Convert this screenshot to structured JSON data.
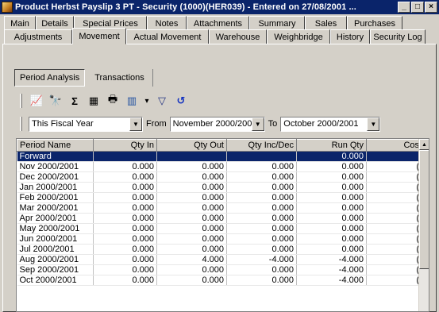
{
  "window": {
    "title": "Product Herbst  Payslip 3 PT - Security (1000)(HER039) - Entered on 27/08/2001 ...",
    "controls": [
      "_",
      "□",
      "×"
    ]
  },
  "tabs_row1": [
    "Main",
    "Details",
    "Special Prices",
    "Notes",
    "Attachments",
    "Summary",
    "Sales",
    "Purchases"
  ],
  "tabs_row2": [
    "Adjustments",
    "Movement",
    "Actual Movement",
    "Warehouse",
    "Weighbridge",
    "History",
    "Security Log"
  ],
  "active_tab": "Movement",
  "subtabs": {
    "period": "Period Analysis",
    "transactions": "Transactions"
  },
  "toolbar": {
    "icons": [
      "chart-icon",
      "binoculars-icon",
      "sum-icon",
      "export-icon",
      "print-icon",
      "columns-icon",
      "dropdown-arrow-icon",
      "filter-icon",
      "refresh-icon"
    ],
    "glyphs": [
      "📈",
      "🔭",
      "Σ",
      "▦",
      "🖶",
      "▥",
      "▾",
      "▽",
      "↺"
    ]
  },
  "filter": {
    "range": "This Fiscal Year",
    "from_label": "From",
    "from_value": "November 2000/200",
    "to_label": "To",
    "to_value": "October 2000/2001"
  },
  "grid": {
    "columns": [
      "Period Name",
      "Qty In",
      "Qty Out",
      "Qty Inc/Dec",
      "Run Qty",
      "Cos"
    ],
    "rows": [
      [
        "Forward",
        "",
        "",
        "",
        "0.000",
        ""
      ],
      [
        "Nov 2000/2001",
        "0.000",
        "0.000",
        "0.000",
        "0.000",
        "("
      ],
      [
        "Dec 2000/2001",
        "0.000",
        "0.000",
        "0.000",
        "0.000",
        "("
      ],
      [
        "Jan 2000/2001",
        "0.000",
        "0.000",
        "0.000",
        "0.000",
        "("
      ],
      [
        "Feb 2000/2001",
        "0.000",
        "0.000",
        "0.000",
        "0.000",
        "("
      ],
      [
        "Mar 2000/2001",
        "0.000",
        "0.000",
        "0.000",
        "0.000",
        "("
      ],
      [
        "Apr 2000/2001",
        "0.000",
        "0.000",
        "0.000",
        "0.000",
        "("
      ],
      [
        "May 2000/2001",
        "0.000",
        "0.000",
        "0.000",
        "0.000",
        "("
      ],
      [
        "Jun 2000/2001",
        "0.000",
        "0.000",
        "0.000",
        "0.000",
        "("
      ],
      [
        "Jul 2000/2001",
        "0.000",
        "0.000",
        "0.000",
        "0.000",
        "("
      ],
      [
        "Aug 2000/2001",
        "0.000",
        "4.000",
        "-4.000",
        "-4.000",
        "("
      ],
      [
        "Sep 2000/2001",
        "0.000",
        "0.000",
        "0.000",
        "-4.000",
        "("
      ],
      [
        "Oct 2000/2001",
        "0.000",
        "0.000",
        "0.000",
        "-4.000",
        "("
      ]
    ],
    "selected_row": 0
  },
  "colors": {
    "titlebar": "#0a246a",
    "selection": "#0a246a",
    "face": "#d4d0c8"
  }
}
